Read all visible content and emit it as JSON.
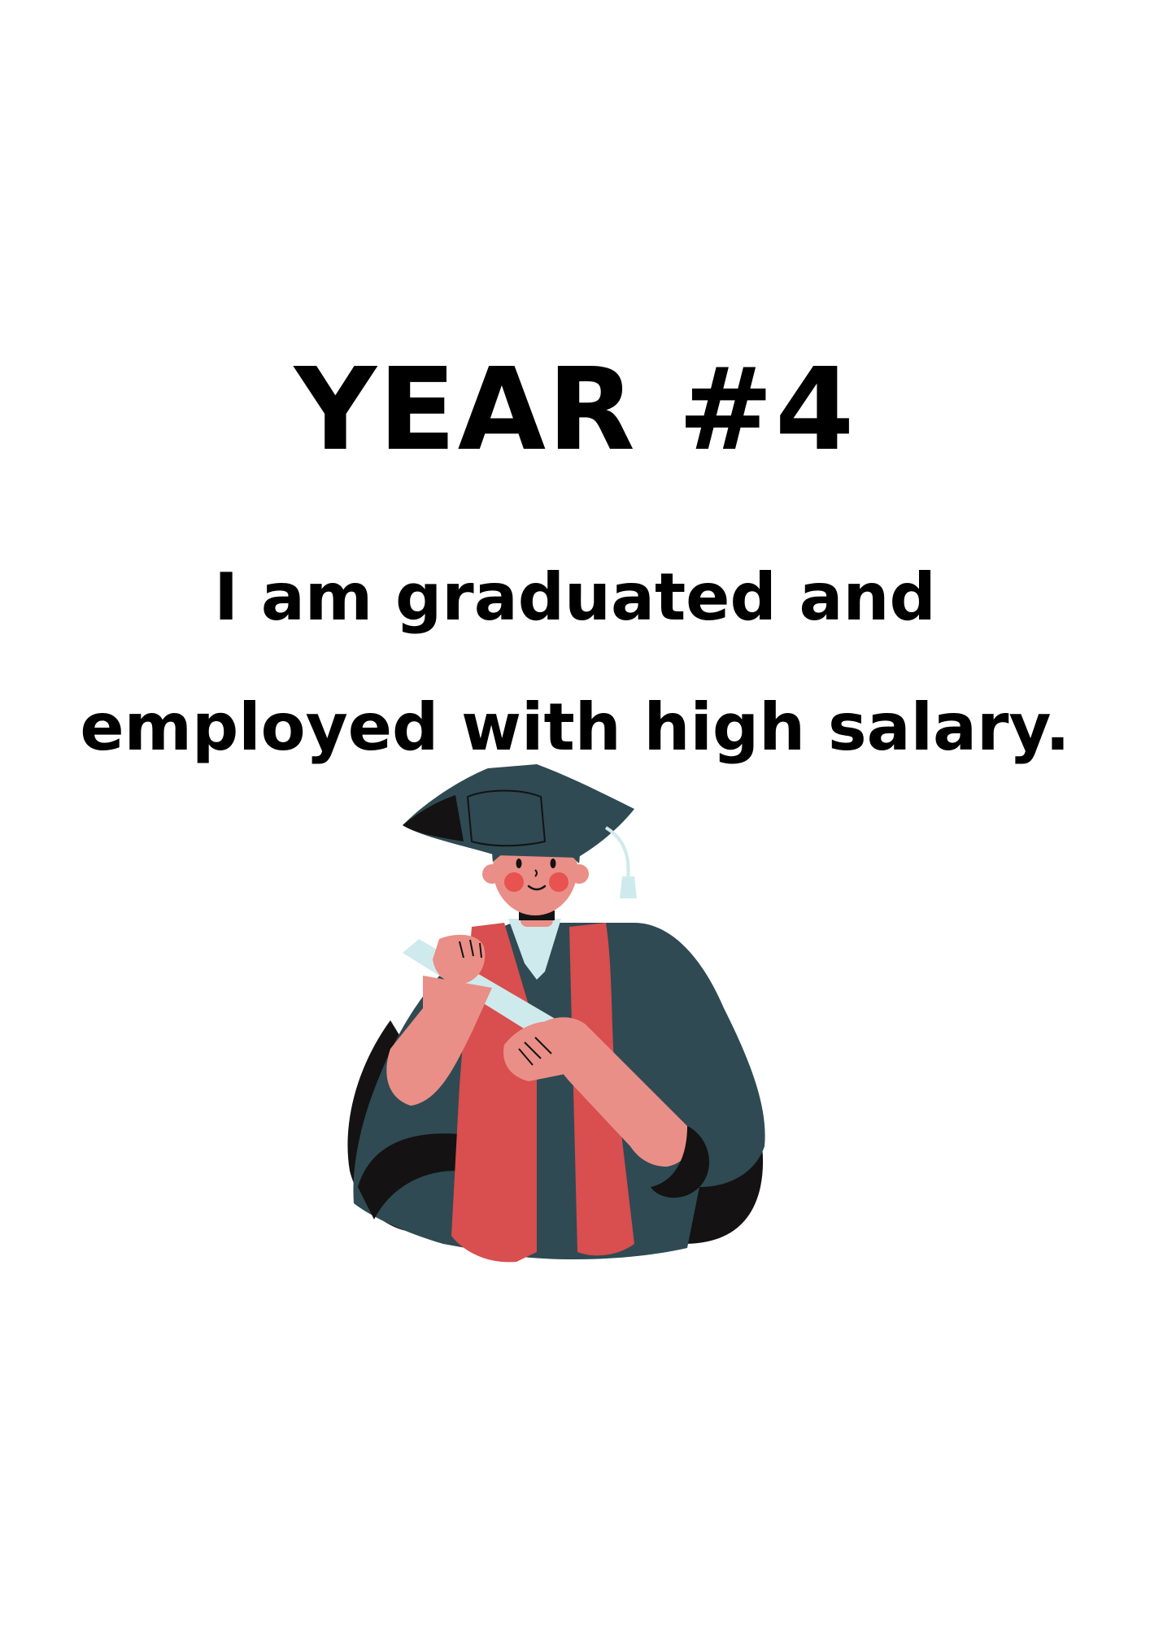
{
  "heading": "YEAR #4",
  "caption": {
    "line1": "I am graduated and",
    "line2": "employed with high salary."
  },
  "illustration": {
    "subject": "graduate-icon",
    "colors": {
      "gown": "#2f4a52",
      "stole": "#d94e4e",
      "skin": "#e98f87",
      "diploma": "#cfeaec",
      "shadow": "#141212",
      "cheeks": "#e8524f"
    }
  }
}
